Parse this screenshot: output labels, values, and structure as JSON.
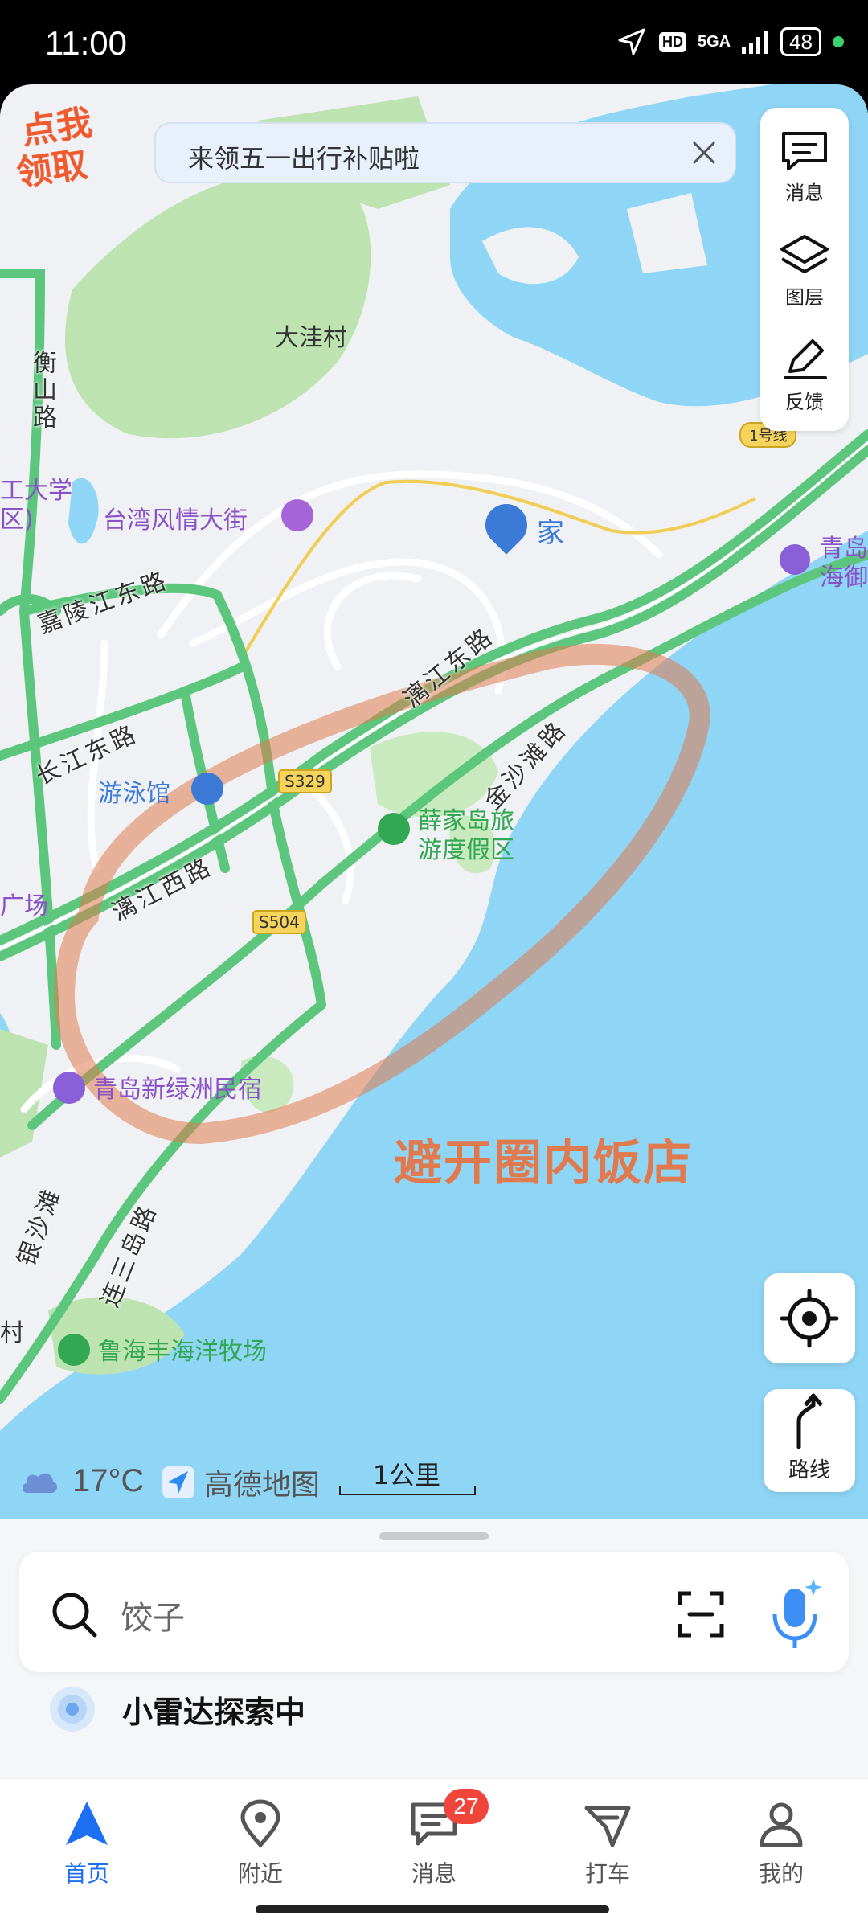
{
  "status_bar": {
    "time": "11:00",
    "network": "5GA",
    "hd": "HD",
    "battery": "48",
    "icons": [
      "location-arrow-icon",
      "signal-icon",
      "battery-icon"
    ]
  },
  "promo": {
    "badge_line1": "点我",
    "badge_line2": "领取",
    "banner_text": "来领五一出行补贴啦"
  },
  "map_tools": {
    "messages": "消息",
    "layers": "图层",
    "feedback": "反馈",
    "route": "路线"
  },
  "map": {
    "places": {
      "dawa": "大洼村",
      "taiwan": "台湾风情大街",
      "home": "家",
      "univ1": "工大学",
      "univ2": "区)",
      "qingdao_yu1": "青岛",
      "qingdao_yu2": "海御",
      "swim": "游泳馆",
      "xuejia1": "薛家岛旅",
      "xuejia2": "游度假区",
      "guangchang": "广场",
      "xinlvzhou": "青岛新绿洲民宿",
      "luhai": "鲁海丰海洋牧场",
      "cun": "村"
    },
    "roads": {
      "hengshan": "衡山路",
      "jialingjiang": "嘉陵江东路",
      "changjiang": "长江东路",
      "lijiang_east": "漓江东路",
      "lijiang_west": "漓江西路",
      "jinshatan": "金沙滩路",
      "liansanxi": "连三岛路",
      "yinshatan": "银沙滩",
      "s329": "S329",
      "s504": "S504",
      "highway": "1号线"
    },
    "annotation": "避开圈内饭店",
    "colors": {
      "water": "#8fd5f5",
      "park": "#bde3b0",
      "road": "#5cc77c",
      "annotation": "#e07a4e"
    }
  },
  "weather": {
    "temperature": "17°C",
    "icon": "cloud-icon"
  },
  "brand": {
    "name": "高德地图"
  },
  "scale": {
    "label": "1公里"
  },
  "search": {
    "value": "饺子"
  },
  "radar": {
    "text": "小雷达探索中"
  },
  "tabs": [
    {
      "label": "首页",
      "icon": "navigation-arrow-icon",
      "active": true
    },
    {
      "label": "附近",
      "icon": "location-pin-icon"
    },
    {
      "label": "消息",
      "icon": "message-icon",
      "badge": "27"
    },
    {
      "label": "打车",
      "icon": "taxi-flag-icon"
    },
    {
      "label": "我的",
      "icon": "person-icon"
    }
  ]
}
